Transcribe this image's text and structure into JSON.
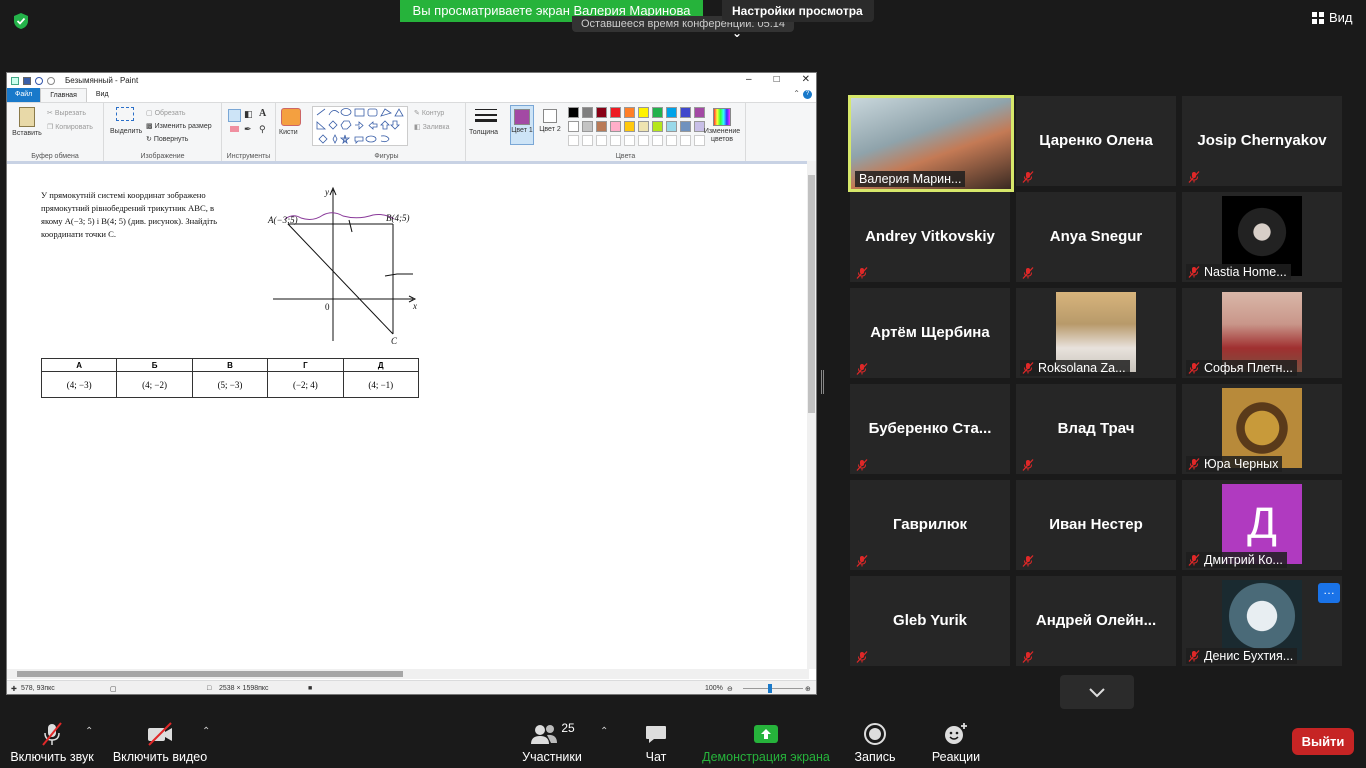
{
  "top": {
    "banner": "Вы просматриваете экран Валерия Маринова",
    "view_options": "Настройки просмотра",
    "timer": "Оставшееся время конференции: 05:14",
    "view_label": "Вид"
  },
  "paint": {
    "title": "Безымянный - Paint",
    "tabs": [
      "Файл",
      "Главная",
      "Вид"
    ],
    "groups": {
      "clipboard": {
        "paste": "Вставить",
        "cut": "Вырезать",
        "copy": "Копировать",
        "label": "Буфер обмена"
      },
      "image": {
        "select": "Выделить",
        "crop": "Обрезать",
        "resize": "Изменить размер",
        "rotate": "Повернуть",
        "label": "Изображение"
      },
      "tools": {
        "label": "Инструменты",
        "brushes": "Кисти"
      },
      "shapes": {
        "label": "Фигуры",
        "outline": "Контур",
        "fill": "Заливка"
      },
      "size": {
        "label": "Толщина"
      },
      "colors": {
        "color1": "Цвет 1",
        "color2": "Цвет 2",
        "edit": "Изменение цветов",
        "label": "Цвета"
      }
    },
    "palette_row1": [
      "#000000",
      "#7f7f7f",
      "#880015",
      "#ed1c24",
      "#ff7f27",
      "#fff200",
      "#22b14c",
      "#00a2e8",
      "#3f48cc",
      "#a349a4"
    ],
    "palette_row2": [
      "#ffffff",
      "#c3c3c3",
      "#b97a57",
      "#ffaec9",
      "#ffc90e",
      "#efe4b0",
      "#b5e61d",
      "#99d9ea",
      "#7092be",
      "#c8bfe7"
    ],
    "color1_value": "#a349a4",
    "status": {
      "cursor": "578, 93пкс",
      "size": "2538 × 1598пкс",
      "zoom": "100%"
    },
    "problem": {
      "line1": "У прямокутній системі координат зображено",
      "line2": "прямокутний рівнобедрений трикутник ABC, в",
      "line3": "якому A(−3; 5) і B(4; 5) (див. рисунок). Знайдіть",
      "line4": "координати точки C."
    },
    "graph": {
      "a_label": "A(−3;5)",
      "b_label": "B(4;5)",
      "c_label": "C",
      "x_label": "x",
      "y_label": "y",
      "origin": "0"
    },
    "answers": {
      "headers": [
        "А",
        "Б",
        "В",
        "Г",
        "Д"
      ],
      "values": [
        "(4; −3)",
        "(4; −2)",
        "(5; −3)",
        "(−2; 4)",
        "(4; −1)"
      ]
    }
  },
  "participants": [
    {
      "name": "Валерия Маринова",
      "label": "Валерия Марин...",
      "active": true
    },
    {
      "name": "Царенко Олена"
    },
    {
      "name": "Josip Chernyakov"
    },
    {
      "name": "Andrey Vitkovskiy"
    },
    {
      "name": "Anya Snegur"
    },
    {
      "name": "Nastia Home...",
      "label": "Nastia Home..."
    },
    {
      "name": "Артём Щербина"
    },
    {
      "name": "Roksolana Za...",
      "label": "Roksolana Za..."
    },
    {
      "name": "Софья Плетн...",
      "label": "Софья Плетн..."
    },
    {
      "name": "Буберенко  Ста..."
    },
    {
      "name": "Влад Трач"
    },
    {
      "name": "Юра Черных",
      "label": "Юра Черных"
    },
    {
      "name": "Гаврилюк"
    },
    {
      "name": "Иван Нестер"
    },
    {
      "name": "Дмитрий Ко...",
      "label": "Дмитрий Ко...",
      "initial": "Д",
      "avatar_color": "#b03ac0"
    },
    {
      "name": "Gleb Yurik"
    },
    {
      "name": "Андрей  Олейн..."
    },
    {
      "name": "Денис Бухтия...",
      "label": "Денис Бухтия..."
    }
  ],
  "toolbar": {
    "audio": "Включить звук",
    "video": "Включить видео",
    "participants": "Участники",
    "participants_count": "25",
    "chat": "Чат",
    "share": "Демонстрация экрана",
    "record": "Запись",
    "reactions": "Реакции",
    "leave": "Выйти"
  },
  "colors": {
    "accent_green": "#26b33b",
    "leave_red": "#c62424",
    "active_border": "#d7e86a",
    "mute_red": "#e02828"
  }
}
